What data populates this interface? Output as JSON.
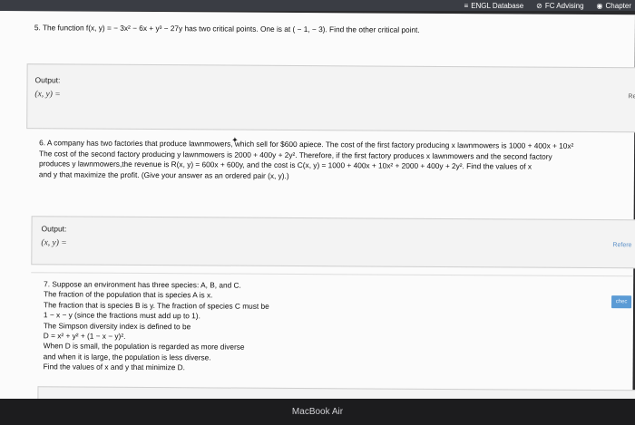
{
  "topbar": {
    "items": [
      {
        "label": "ENGL Database",
        "icon": "menu-icon"
      },
      {
        "label": "FC Advising",
        "icon": "link-icon"
      },
      {
        "label": "Chapter",
        "icon": "globe-icon"
      }
    ]
  },
  "q5": {
    "text": "5. The function f(x, y) = − 3x² − 6x + y³ − 27y has two critical points. One is at ( − 1,  − 3). Find the other critical point.",
    "output_label": "Output:",
    "xy_label": "(x, y) =",
    "side": "Re"
  },
  "q6": {
    "line1": "6. A company has two factories that produce lawnmowers, which sell for $600 apiece. The cost of the first factory producing x lawnmowers is 1000 + 400x + 10x²",
    "line2": "The cost of the second factory producing y lawnmowers is 2000 + 400y + 2y². Therefore, if the first factory produces x lawnmowers and the second factory",
    "line3": "produces y lawnmowers,the revenue is R(x, y) = 600x + 600y, and the cost is C(x, y) = 1000 + 400x + 10x² + 2000 + 400y + 2y². Find the values of x",
    "line4": "and y that maximize the profit. (Give your answer as an ordered pair (x, y).)",
    "output_label": "Output:",
    "xy_label": "(x, y) =",
    "reference": "Refere"
  },
  "q7": {
    "lines": [
      "7. Suppose an environment has three species: A, B, and C.",
      "The fraction of the population that is species A is x.",
      "The fraction that is species B is y. The fraction of species C must be",
      "1 − x − y (since the fractions must add up to 1).",
      "The Simpson diversity index is defined to be",
      "D = x² + y² + (1 − x − y)².",
      "When D is small, the population is regarded as more diverse",
      "and when it is large, the population is less diverse.",
      "Find the values of x and y that minimize D."
    ],
    "check": "chec"
  },
  "bezel": {
    "label": "MacBook Air"
  },
  "colors": {
    "link": "#5a8fc7",
    "check_button": "#5b9bd5",
    "page": "#fbfbfb"
  }
}
